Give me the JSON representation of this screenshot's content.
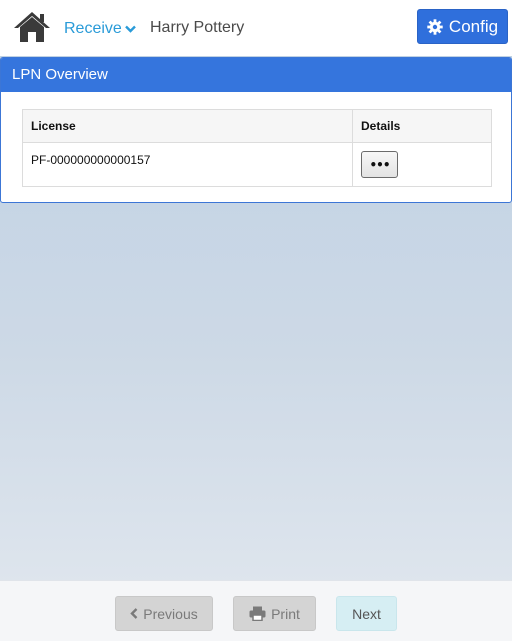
{
  "header": {
    "menu_label": "Receive",
    "user_name": "Harry Pottery",
    "config_label": "Config"
  },
  "panel": {
    "title": "LPN Overview",
    "columns": [
      "License",
      "Details"
    ],
    "rows": [
      {
        "license": "PF-000000000000157",
        "details_label": "•••"
      }
    ]
  },
  "footer": {
    "previous_label": "Previous",
    "print_label": "Print",
    "next_label": "Next"
  },
  "icons": {
    "home": "home-icon",
    "menu_chevron": "chevron-down-icon",
    "config": "gear-icon",
    "previous": "chevron-left-icon",
    "print": "printer-icon"
  },
  "colors": {
    "accent": "#2f6fdc",
    "panel_header": "#3575dd",
    "link": "#2a9bd8"
  }
}
